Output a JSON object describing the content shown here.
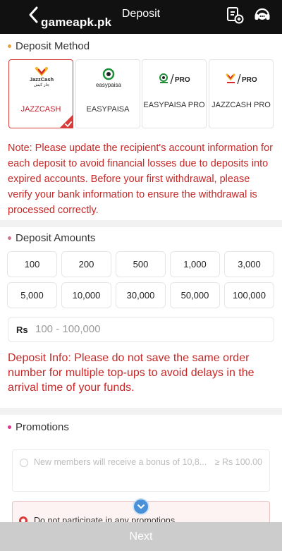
{
  "header": {
    "site_name": "gameapk.pk",
    "title": "Deposit",
    "icons": [
      "back-arrow-icon",
      "order-history-icon",
      "customer-support-icon"
    ]
  },
  "method_section": {
    "title": "Deposit Method",
    "methods": [
      {
        "label": "JAZZCASH",
        "logo_text": "JazzCash",
        "selected": true
      },
      {
        "label": "EASYPAISA",
        "logo_text": "easypaisa",
        "selected": false
      },
      {
        "label": "EASYPAISA PRO",
        "logo_text": "PRO",
        "selected": false
      },
      {
        "label": "JAZZCASH PRO",
        "logo_text": "PRO",
        "selected": false
      }
    ]
  },
  "note": "Note: Please update the recipient's account information for each deposit to avoid financial losses due to deposits into expired accounts. Before your first withdrawal, please verify your bank information to ensure the withdrawal is processed correctly.",
  "amount_section": {
    "title": "Deposit Amounts",
    "amounts": [
      "100",
      "200",
      "500",
      "1,000",
      "3,000",
      "5,000",
      "10,000",
      "30,000",
      "50,000",
      "100,000"
    ],
    "currency": "Rs",
    "placeholder": "100 - 100,000"
  },
  "deposit_info": "Deposit Info: Please do not save the same order number for multiple top-ups to avoid delays in the arrival time of your funds.",
  "promotions": {
    "title": "Promotions",
    "options": [
      {
        "text": "New members will receive a bonus of 10,8...",
        "value": "≥ Rs 100.00"
      },
      {
        "text": "Do not participate in any promotions",
        "value": ""
      }
    ]
  },
  "next_label": "Next",
  "colors": {
    "accent_red": "#c62828",
    "header_bg": "#111111",
    "section_dot_orange": "#e8a33b",
    "section_dot_pink": "#d0768f",
    "section_dot_magenta": "#e0338a",
    "next_disabled": "#cccccc"
  }
}
